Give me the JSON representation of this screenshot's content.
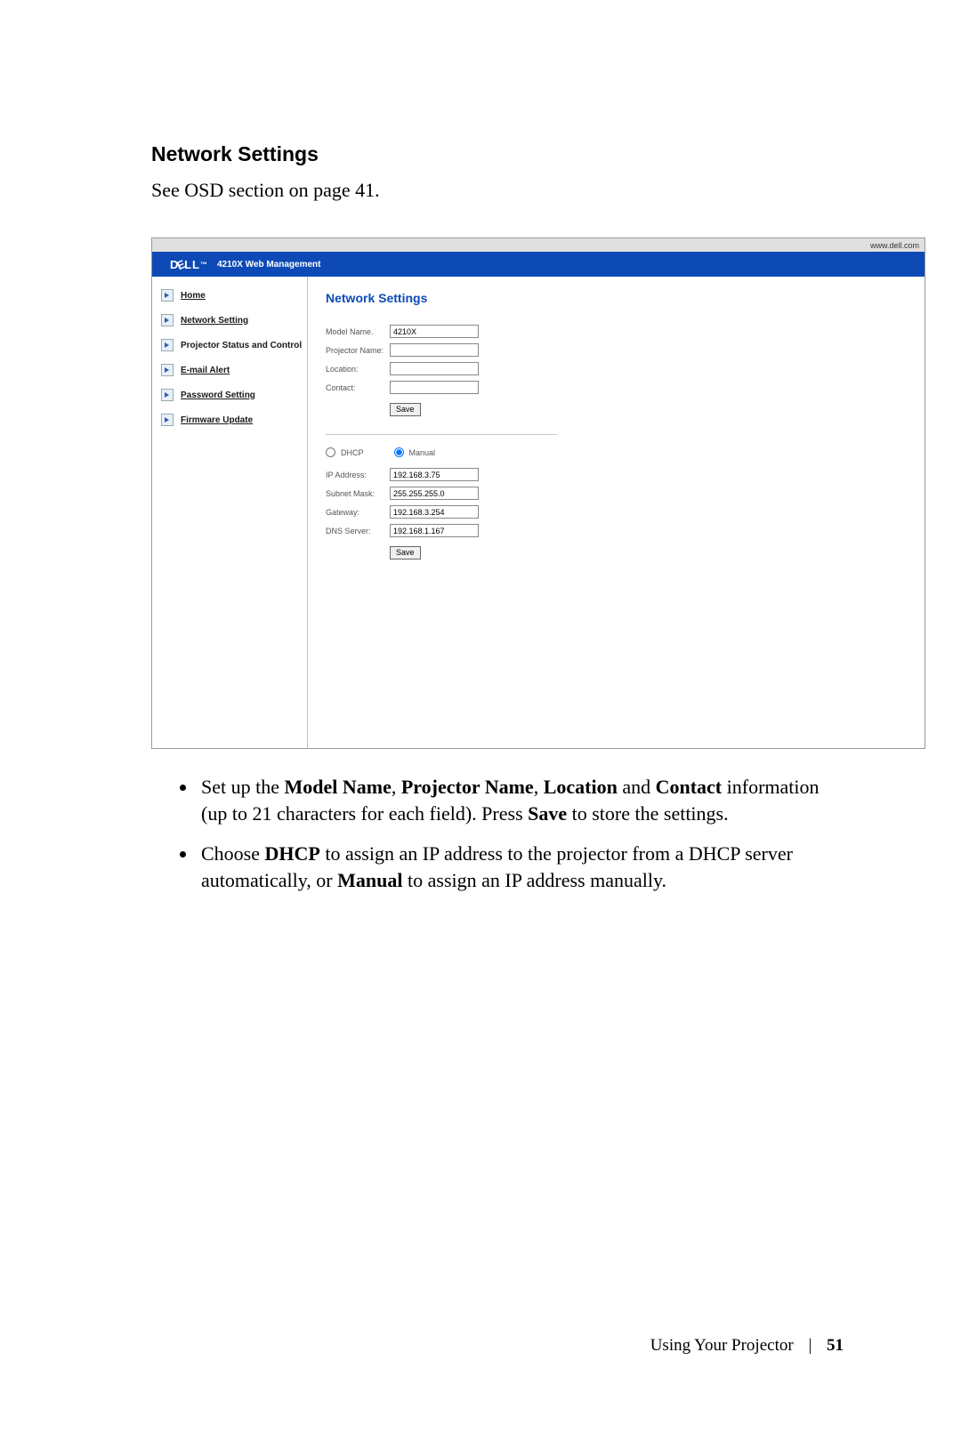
{
  "heading": "Network Settings",
  "intro": "See OSD section on page 41.",
  "urlbar": "www.dell.com",
  "logo_text": "DELL",
  "logo_sub": "4210X Web Management",
  "nav": {
    "home": "Home",
    "network": "Network Setting",
    "status": "Projector Status and Control",
    "email": "E-mail Alert",
    "password": "Password Setting",
    "firmware": "Firmware Update"
  },
  "panel": {
    "title": "Network Settings",
    "labels": {
      "model": "Model Name.",
      "projector": "Projector Name:",
      "location": "Location:",
      "contact": "Contact:",
      "ip": "IP Address:",
      "subnet": "Subnet Mask:",
      "gateway": "Gateway:",
      "dns": "DNS Server:"
    },
    "values": {
      "model": "4210X",
      "projector": "",
      "location": "",
      "contact": "",
      "ip": "192.168.3.75",
      "subnet": "255.255.255.0",
      "gateway": "192.168.3.254",
      "dns": "192.168.1.167"
    },
    "radios": {
      "dhcp": "DHCP",
      "manual": "Manual"
    },
    "save": "Save"
  },
  "bullet1_a": "Set up the ",
  "bullet1_b1": "Model Name",
  "bullet1_b2": "Projector Name",
  "bullet1_b3": "Location",
  "bullet1_b4": "Contact",
  "bullet1_c": " information (up to 21 characters for each field). Press ",
  "bullet1_d": "Save",
  "bullet1_e": " to store the settings.",
  "bullet2_a": "Choose ",
  "bullet2_b1": "DHCP",
  "bullet2_c": " to assign an IP address to the projector from a DHCP server automatically, or ",
  "bullet2_b2": "Manual",
  "bullet2_d": " to assign an IP address manually.",
  "footer_text": "Using Your Projector",
  "page_number": "51"
}
